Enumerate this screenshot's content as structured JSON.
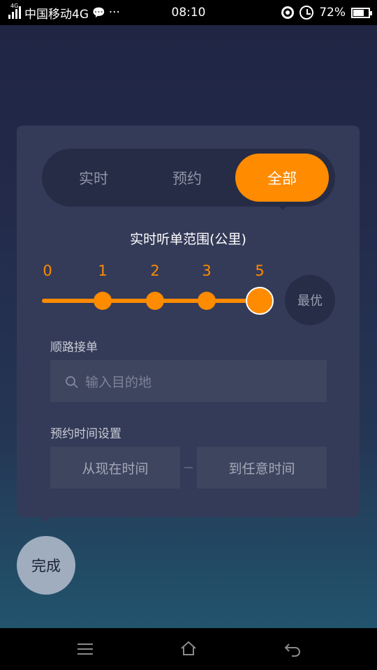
{
  "status_bar": {
    "carrier": "中国移动4G",
    "net_badge": "4G",
    "more": "···",
    "time": "08:10",
    "battery": "72%",
    "battery_level": 0.72
  },
  "mode_tabs": {
    "items": [
      "实时",
      "预约",
      "全部"
    ],
    "active_index": 2
  },
  "range": {
    "title": "实时听单范围(公里)",
    "ticks": [
      "0",
      "1",
      "2",
      "3",
      "5"
    ],
    "selected": "5",
    "best_label": "最优"
  },
  "route": {
    "label": "顺路接单",
    "destination_placeholder": "输入目的地"
  },
  "booking_time": {
    "label": "预约时间设置",
    "from_placeholder": "从现在时间",
    "to_placeholder": "到任意时间"
  },
  "done_label": "完成",
  "colors": {
    "accent": "#ff8b00",
    "panel": "#343b58",
    "segment_bg": "#262c45"
  },
  "icons": [
    "signal-icon",
    "wechat-icon",
    "location-icon",
    "alarm-icon",
    "battery-icon",
    "search-icon",
    "menu-icon",
    "home-icon",
    "back-icon"
  ]
}
